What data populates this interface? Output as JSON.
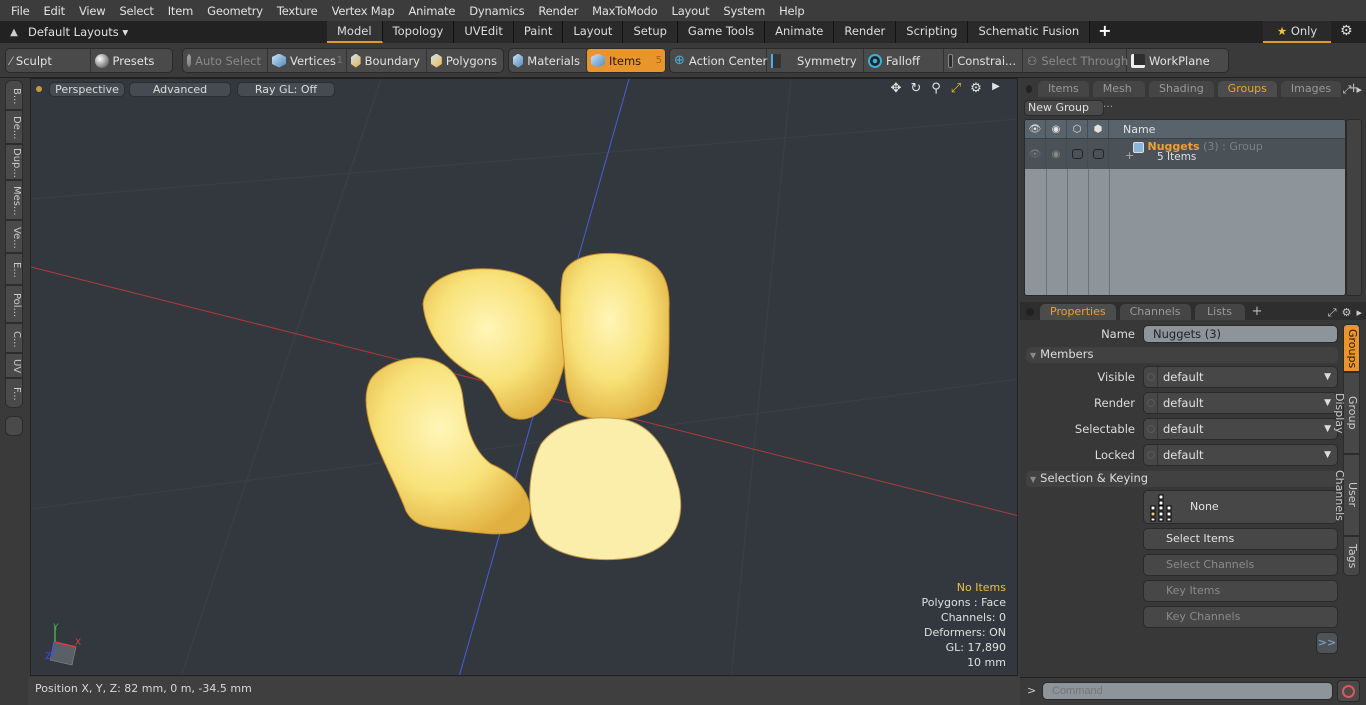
{
  "menu": [
    "File",
    "Edit",
    "View",
    "Select",
    "Item",
    "Geometry",
    "Texture",
    "Vertex Map",
    "Animate",
    "Dynamics",
    "Render",
    "MaxToModo",
    "Layout",
    "System",
    "Help"
  ],
  "layout_bar": {
    "layout_selector": "Default Layouts ▾",
    "tabs": [
      "Model",
      "Topology",
      "UVEdit",
      "Paint",
      "Layout",
      "Setup",
      "Game Tools",
      "Animate",
      "Render",
      "Scripting",
      "Schematic Fusion"
    ],
    "active_tab": "Model",
    "add_tab": "+",
    "only_label": "Only",
    "star": "★",
    "gear": "⚙"
  },
  "toolbar": {
    "sculpt": "Sculpt",
    "presets": "Presets",
    "auto_select": "Auto Select",
    "vertices": "Vertices",
    "vertices_count": "1",
    "boundary": "Boundary",
    "polygons": "Polygons",
    "materials": "Materials",
    "items": "Items",
    "items_count": "5",
    "action_center": "Action Center",
    "symmetry": "Symmetry",
    "falloff": "Falloff",
    "constraints": "Constrai...",
    "select_through": "Select Through",
    "workplane": "WorkPlane"
  },
  "left_tabs": [
    "B...",
    "De...",
    "Dup...",
    "Mes...",
    "Ve...",
    "E...",
    "Pol...",
    "C...",
    "UV",
    "F..."
  ],
  "viewport": {
    "view_mode": "Perspective",
    "shading": "Advanced",
    "raygl": "Ray GL: Off",
    "info": {
      "selection": "No Items",
      "polygons": "Polygons : Face",
      "channels": "Channels: 0",
      "deformers": "Deformers: ON",
      "gl": "GL: 17,890",
      "scale": "10 mm"
    },
    "axis_labels": {
      "x": "X",
      "y": "Y",
      "z": "Z"
    },
    "object": "4 chicken nuggets"
  },
  "status": {
    "position": "Position X, Y, Z:   82 mm, 0 m, -34.5 mm"
  },
  "groups_panel": {
    "tabs": [
      "Items",
      "Mesh ...",
      "Shading",
      "Groups",
      "Images"
    ],
    "active_tab": "Groups",
    "new_group": "New Group",
    "column_name": "Name",
    "group": {
      "name": "Nuggets",
      "count": "(3)",
      "type": ": Group",
      "items": "5 Items"
    }
  },
  "properties_panel": {
    "tabs": [
      "Properties",
      "Channels",
      "Lists"
    ],
    "active_tab": "Properties",
    "name_label": "Name",
    "name_value": "Nuggets (3)",
    "members_section": "Members",
    "fields": [
      {
        "label": "Visible",
        "value": "default"
      },
      {
        "label": "Render",
        "value": "default"
      },
      {
        "label": "Selectable",
        "value": "default"
      },
      {
        "label": "Locked",
        "value": "default"
      }
    ],
    "selection_section": "Selection & Keying",
    "none_button": "None",
    "buttons": [
      "Select Items",
      "Select Channels",
      "Key Items",
      "Key Channels"
    ],
    "more": ">>",
    "side_tabs": [
      "Groups",
      "Group Display",
      "User Channels",
      "Tags"
    ]
  },
  "command": {
    "prompt": ">",
    "placeholder": "Command"
  }
}
